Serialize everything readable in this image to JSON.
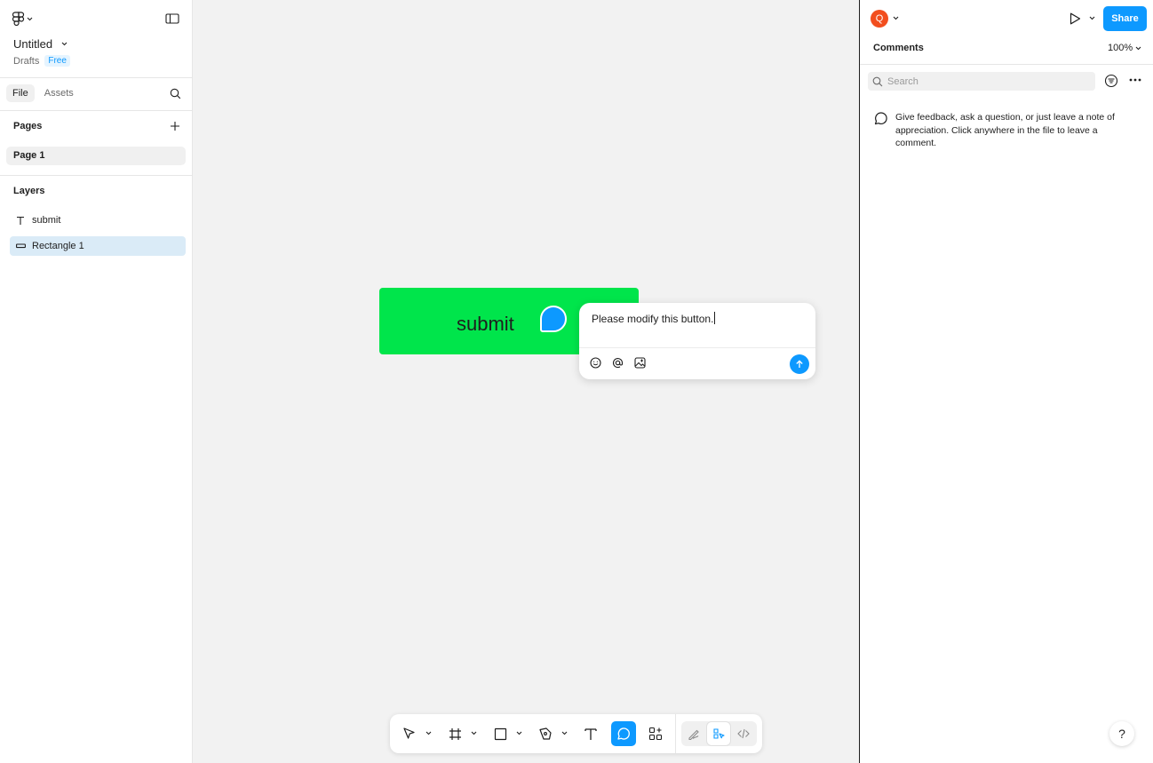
{
  "file": {
    "title": "Untitled",
    "location": "Drafts",
    "plan_badge": "Free"
  },
  "left_tabs": [
    {
      "label": "File",
      "active": true
    },
    {
      "label": "Assets",
      "active": false
    }
  ],
  "pages": {
    "heading": "Pages",
    "items": [
      {
        "label": "Page 1",
        "selected": true
      }
    ]
  },
  "layers": {
    "heading": "Layers",
    "items": [
      {
        "label": "submit",
        "icon": "text-layer-icon",
        "selected": false
      },
      {
        "label": "Rectangle 1",
        "icon": "rectangle-layer-icon",
        "selected": true
      }
    ]
  },
  "canvas": {
    "button_text": "submit",
    "button_color": "#00e54b",
    "comment_draft": "Please modify this button."
  },
  "toolbar": {
    "tools": [
      "move-tool",
      "frame-tool",
      "rectangle-tool",
      "pen-tool",
      "text-tool",
      "comment-tool",
      "actions-tool"
    ],
    "active_tool": "comment-tool",
    "modes": [
      "draw-mode",
      "design-mode",
      "dev-mode"
    ],
    "active_mode": "design-mode"
  },
  "right_panel": {
    "avatar_initial": "Q",
    "share_label": "Share",
    "title": "Comments",
    "zoom": "100%",
    "search_placeholder": "Search",
    "empty_message": "Give feedback, ask a question, or just leave a note of appreciation. Click anywhere in the file to leave a comment.",
    "help_label": "?"
  },
  "colors": {
    "accent": "#0d99ff",
    "avatar": "#f24e1e",
    "selection": "#daebf7"
  }
}
